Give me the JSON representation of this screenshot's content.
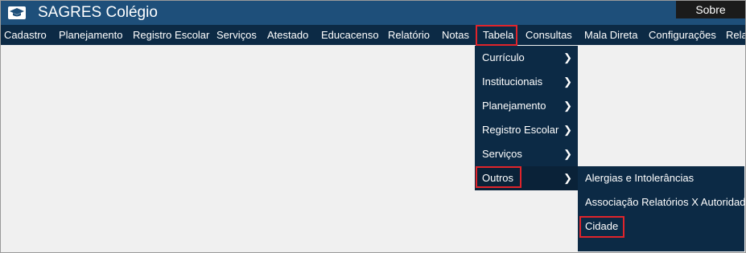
{
  "app": {
    "title": "SAGRES Colégio",
    "about_label": "Sobre",
    "logo_icon": "graduation-cap-icon"
  },
  "menubar": {
    "items": [
      "Cadastro",
      "Planejamento",
      "Registro Escolar",
      "Serviços",
      "Atestado",
      "Educacenso",
      "Relatório",
      "Notas",
      "Tabela",
      "Consultas",
      "Mala Direta",
      "Configurações",
      "Rela"
    ],
    "active": "Tabela"
  },
  "tabela_menu": {
    "items": [
      "Currículo",
      "Institucionais",
      "Planejamento",
      "Registro Escolar",
      "Serviços",
      "Outros"
    ],
    "chevron_icon": "chevron-right-icon",
    "active": "Outros"
  },
  "outros_submenu": {
    "items": [
      "Alergias e Intolerâncias",
      "Associação Relatórios X Autoridades",
      "Cidade"
    ],
    "highlighted": "Cidade"
  },
  "colors": {
    "header": "#1e4f7a",
    "menubar": "#0c2a45",
    "highlight": "#e0242b",
    "background": "#f0f0f0"
  }
}
